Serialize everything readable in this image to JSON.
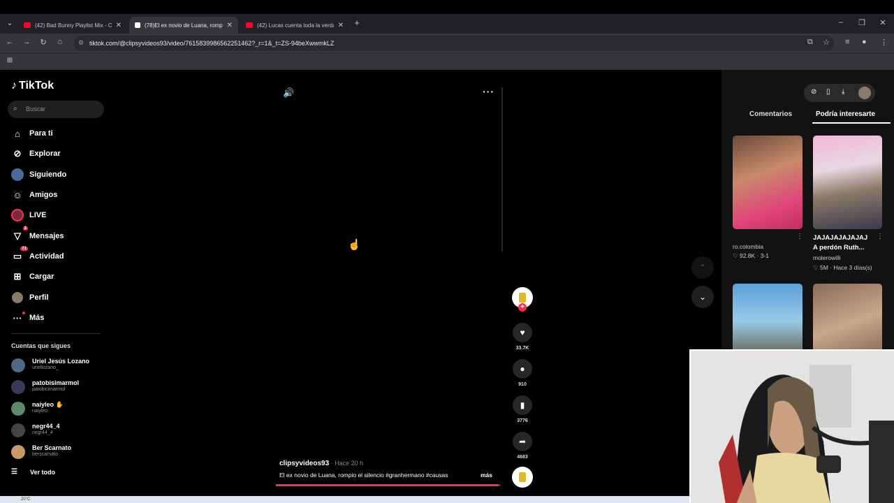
{
  "browser": {
    "tabs": [
      {
        "title": "(42) Bad Bunny Playlist Mix - Cu",
        "favicon_color": "#ff0033"
      },
      {
        "title": "(78)El ex novio de Luana, rompi",
        "favicon_color": "#ffffff"
      },
      {
        "title": "(42) Lucas cuenta toda la verda",
        "favicon_color": "#ff0033"
      }
    ],
    "new_tab": "+",
    "url": "tiktok.com/@clipsyvideos93/video/7615839986562251462?_r=1&_t=ZS-94beXwwmkLZ"
  },
  "sidebar": {
    "logo": "TikTok",
    "search_placeholder": "Buscar",
    "nav": [
      {
        "label": "Para ti",
        "icon": "home-icon"
      },
      {
        "label": "Explorar",
        "icon": "compass-icon"
      },
      {
        "label": "Siguiendo",
        "icon": "following-avatar-icon"
      },
      {
        "label": "Amigos",
        "icon": "friends-icon"
      },
      {
        "label": "LIVE",
        "icon": "live-icon"
      },
      {
        "label": "Mensajes",
        "icon": "send-icon",
        "badge": "2"
      },
      {
        "label": "Actividad",
        "icon": "inbox-icon",
        "badge": "71"
      },
      {
        "label": "Cargar",
        "icon": "upload-icon"
      },
      {
        "label": "Perfil",
        "icon": "profile-avatar-icon"
      },
      {
        "label": "Más",
        "icon": "more-dots-icon"
      }
    ],
    "following_title": "Cuentas que sigues",
    "accounts": [
      {
        "name": "Uriel Jesús Lozano",
        "handle": "uriellozano_"
      },
      {
        "name": "patobisimarmol",
        "handle": "patobicimarmol"
      },
      {
        "name": "naiyleo",
        "handle": "naiyleo"
      },
      {
        "name": "negr44_4",
        "handle": "negr44_4"
      },
      {
        "name": "Ber Scarnato",
        "handle": "berscarnato"
      }
    ],
    "see_all": "Ver todo"
  },
  "video": {
    "username": "clipsyvideos93",
    "time": " · Hace 20 h",
    "description": "El ex novio de Luana, rompio el silencio #granhermano #causas",
    "more": "más",
    "progress": 0.99
  },
  "actions": {
    "likes": "33.7K",
    "comments": "910",
    "saves": "3776",
    "shares": "4683"
  },
  "panel": {
    "tab_comments": "Comentarios",
    "tab_suggested": "Podría interesarte",
    "cards": [
      {
        "title": "",
        "author": "ro.colombia",
        "stats": "♡ 92.8K · 3-1"
      },
      {
        "title": "JAJAJAJAJAJAJ",
        "subtitle": "A perdón Ruth...",
        "author": "molerowilli",
        "stats": "♡ 5M · Hace 3 días(s)"
      }
    ]
  },
  "taskbar": {
    "weather": "20°C"
  }
}
